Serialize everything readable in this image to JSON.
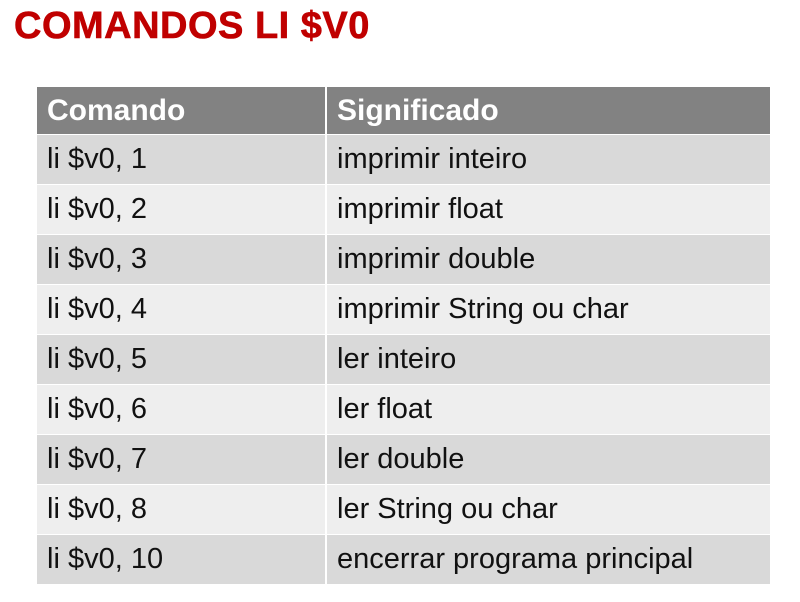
{
  "title": "COMANDOS LI $V0",
  "table": {
    "headers": [
      "Comando",
      "Significado"
    ],
    "rows": [
      {
        "comando": "li $v0, 1",
        "significado": "imprimir inteiro"
      },
      {
        "comando": "li $v0, 2",
        "significado": "imprimir float"
      },
      {
        "comando": "li $v0, 3",
        "significado": "imprimir double"
      },
      {
        "comando": "li $v0, 4",
        "significado": "imprimir String ou char"
      },
      {
        "comando": "li $v0, 5",
        "significado": "ler inteiro"
      },
      {
        "comando": "li $v0, 6",
        "significado": "ler float"
      },
      {
        "comando": "li $v0, 7",
        "significado": "ler double"
      },
      {
        "comando": "li $v0, 8",
        "significado": "ler String ou char"
      },
      {
        "comando": "li $v0, 10",
        "significado": "encerrar programa principal"
      }
    ]
  },
  "colors": {
    "title": "#c00000",
    "header_bg": "#828282",
    "row_dark": "#d9d9d9",
    "row_light": "#eeeeee"
  }
}
